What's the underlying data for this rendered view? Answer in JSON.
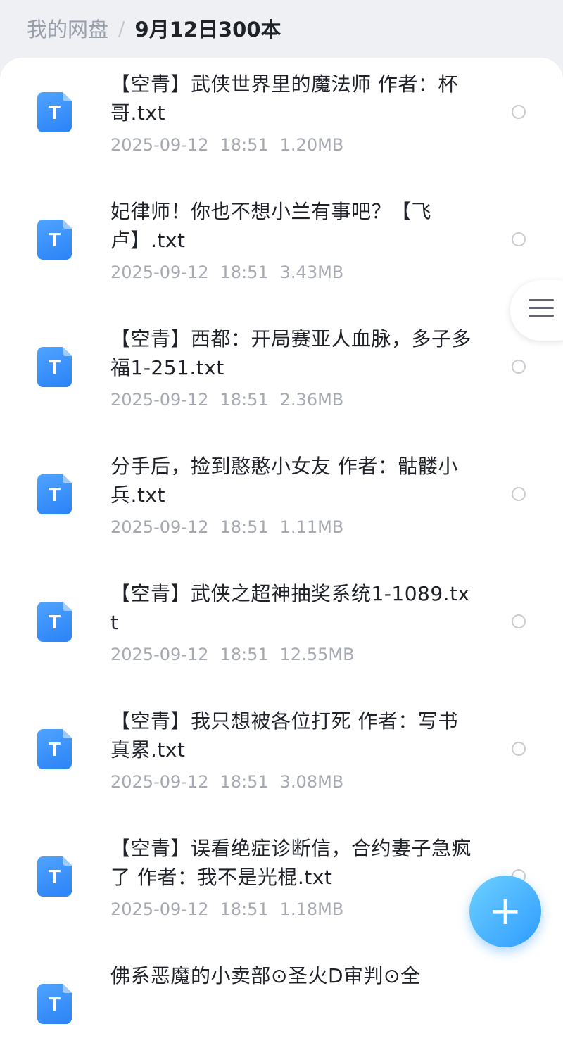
{
  "breadcrumb": {
    "root": "我的网盘",
    "separator": "/",
    "current": "9月12日300本"
  },
  "colors": {
    "accent": "#2f9bff",
    "file_icon": "#2b83f6",
    "meta_text": "#a5a9b1"
  },
  "files": [
    {
      "name": "【空青】武侠世界里的魔法师 作者：杯哥.txt",
      "date": "2025-09-12",
      "time": "18:51",
      "size": "1.20MB",
      "icon": "txt-file-icon"
    },
    {
      "name": "妃律师！你也不想小兰有事吧？【飞卢】.txt",
      "date": "2025-09-12",
      "time": "18:51",
      "size": "3.43MB",
      "icon": "txt-file-icon"
    },
    {
      "name": "【空青】西都：开局赛亚人血脉，多子多福1-251.txt",
      "date": "2025-09-12",
      "time": "18:51",
      "size": "2.36MB",
      "icon": "txt-file-icon"
    },
    {
      "name": "分手后，捡到憨憨小女友 作者：骷髅小兵.txt",
      "date": "2025-09-12",
      "time": "18:51",
      "size": "1.11MB",
      "icon": "txt-file-icon"
    },
    {
      "name": "【空青】武侠之超神抽奖系统1-1089.txt",
      "date": "2025-09-12",
      "time": "18:51",
      "size": "12.55MB",
      "icon": "txt-file-icon"
    },
    {
      "name": "【空青】我只想被各位打死 作者：写书真累.txt",
      "date": "2025-09-12",
      "time": "18:51",
      "size": "3.08MB",
      "icon": "txt-file-icon"
    },
    {
      "name": "【空青】误看绝症诊断信，合约妻子急疯了 作者：我不是光棍.txt",
      "date": "2025-09-12",
      "time": "18:51",
      "size": "1.18MB",
      "icon": "txt-file-icon"
    },
    {
      "name": "佛系恶魔的小卖部⊙圣火D审判⊙全",
      "date": "",
      "time": "",
      "size": "",
      "icon": "txt-file-icon"
    }
  ],
  "file_icon_glyph": "T",
  "side_menu_icon": "menu-icon",
  "fab": {
    "icon": "plus-icon",
    "glyph": "+"
  }
}
